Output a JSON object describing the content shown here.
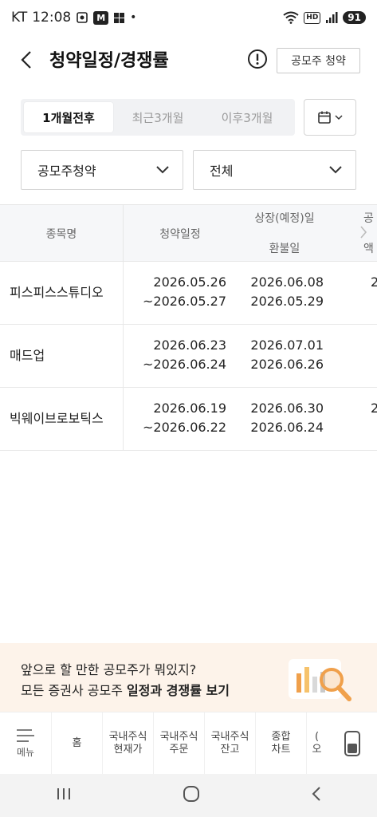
{
  "status_bar": {
    "carrier": "KT",
    "time": "12:08",
    "app_badge": "M",
    "dot": "•",
    "network_badge": "HD",
    "battery": "91"
  },
  "header": {
    "title": "청약일정/경쟁률",
    "ipo_button": "공모주 청약"
  },
  "period_tabs": [
    {
      "label": "1개월전후",
      "active": true
    },
    {
      "label": "최근3개월",
      "active": false
    },
    {
      "label": "이후3개월",
      "active": false
    }
  ],
  "filters": {
    "type_selected": "공모주청약",
    "scope_selected": "전체"
  },
  "table": {
    "headers": {
      "name": "종목명",
      "schedule": "청약일정",
      "listing": "상장(예정)일",
      "refund": "환불일",
      "extra_top": "공",
      "extra_bottom": "액"
    },
    "rows": [
      {
        "name": "피스피스스튜디오",
        "sub_start": "2026.05.26",
        "sub_end": "~2026.05.27",
        "listing": "2026.06.08",
        "refund": "2026.05.29",
        "extra": "2"
      },
      {
        "name": "매드업",
        "sub_start": "2026.06.23",
        "sub_end": "~2026.06.24",
        "listing": "2026.07.01",
        "refund": "2026.06.26",
        "extra": ""
      },
      {
        "name": "빅웨이브로보틱스",
        "sub_start": "2026.06.19",
        "sub_end": "~2026.06.22",
        "listing": "2026.06.30",
        "refund": "2026.06.24",
        "extra": "2"
      }
    ]
  },
  "banner": {
    "line1": "앞으로 할 만한 공모주가 뭐있지?",
    "line2_prefix": "모든 증권사 공모주 ",
    "line2_bold": "일정과 경쟁률 보기"
  },
  "bottom_nav": {
    "menu_label": "메뉴",
    "items": [
      {
        "l1": "홈",
        "l2": ""
      },
      {
        "l1": "국내주식",
        "l2": "현재가"
      },
      {
        "l1": "국내주식",
        "l2": "주문"
      },
      {
        "l1": "국내주식",
        "l2": "잔고"
      },
      {
        "l1": "종합",
        "l2": "차트"
      },
      {
        "l1": "(",
        "l2": "오"
      }
    ]
  },
  "colors": {
    "banner_bg": "#fdf3ea",
    "table_header_bg": "#f6f7f9",
    "tab_bg": "#f1f2f4",
    "accent_orange": "#f0a04b"
  }
}
